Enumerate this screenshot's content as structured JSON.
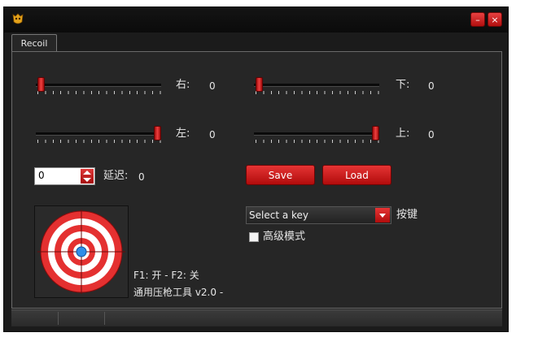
{
  "window": {
    "minimize_symbol": "–",
    "close_symbol": "×",
    "accent_color": "#d62525"
  },
  "tabs": [
    {
      "label": "Recoil",
      "active": true
    }
  ],
  "sliders": [
    {
      "id": "right",
      "label": "右:",
      "value": "0",
      "position": 0.0
    },
    {
      "id": "down",
      "label": "下:",
      "value": "0",
      "position": 0.0
    },
    {
      "id": "left",
      "label": "左:",
      "value": "0",
      "position": 1.0
    },
    {
      "id": "up",
      "label": "上:",
      "value": "0",
      "position": 1.0
    }
  ],
  "delay": {
    "input_value": "0",
    "label": "延迟:",
    "value": "0"
  },
  "buttons": {
    "save": "Save",
    "load": "Load"
  },
  "key_select": {
    "selected": "Select a key",
    "label": "按键"
  },
  "advanced": {
    "label": "高级模式",
    "checked": false
  },
  "hotkeys_text": "F1: 开 - F2: 关",
  "app_name": "通用压枪工具 v2.0   -"
}
